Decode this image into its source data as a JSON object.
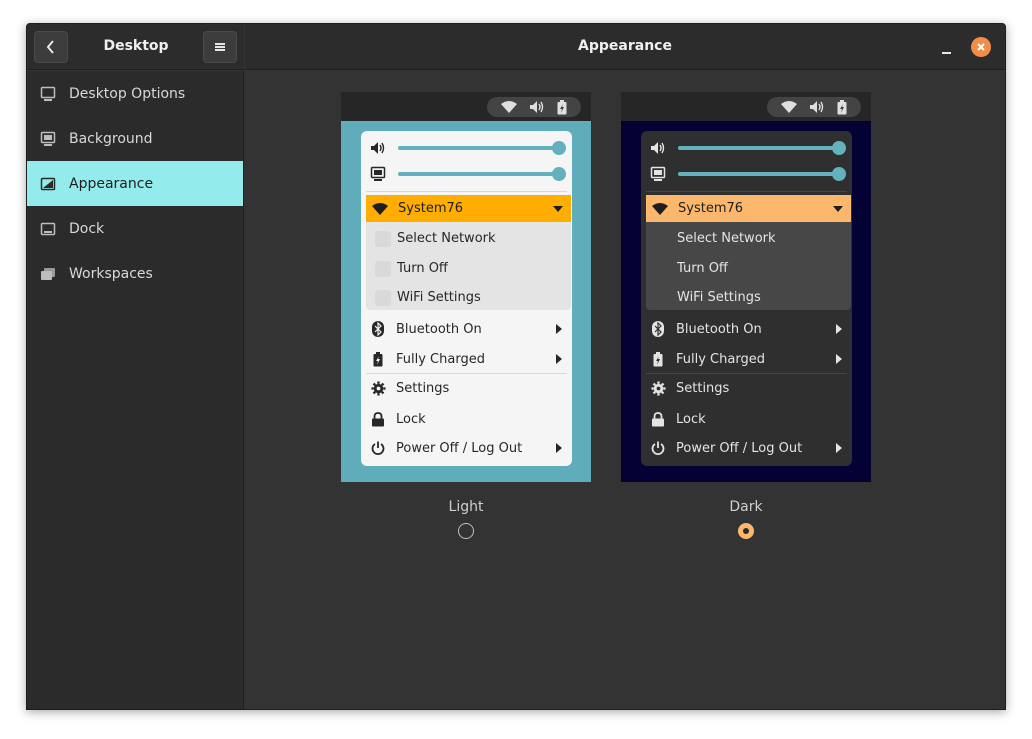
{
  "colors": {
    "accent": "#94ebeb",
    "close_button": "#f08d49",
    "light_highlight": "#ffad00",
    "dark_highlight": "#fbb86c",
    "radio_selected": "#fbb86c"
  },
  "sidebar": {
    "title": "Desktop",
    "back_icon": "chevron-left-icon",
    "menu_icon": "hamburger-menu-icon",
    "items": [
      {
        "label": "Desktop Options",
        "icon": "monitor-icon",
        "active": false
      },
      {
        "label": "Background",
        "icon": "background-icon",
        "active": false
      },
      {
        "label": "Appearance",
        "icon": "appearance-icon",
        "active": true
      },
      {
        "label": "Dock",
        "icon": "dock-icon",
        "active": false
      },
      {
        "label": "Workspaces",
        "icon": "workspaces-icon",
        "active": false
      }
    ]
  },
  "main": {
    "title": "Appearance"
  },
  "menu_text": {
    "network": "System76",
    "select_network": "Select Network",
    "turn_off": "Turn Off",
    "wifi_settings": "WiFi Settings",
    "bluetooth": "Bluetooth On",
    "battery": "Fully Charged",
    "settings": "Settings",
    "lock": "Lock",
    "power": "Power Off / Log Out"
  },
  "themes": [
    {
      "label": "Light",
      "selected": false
    },
    {
      "label": "Dark",
      "selected": true
    }
  ]
}
